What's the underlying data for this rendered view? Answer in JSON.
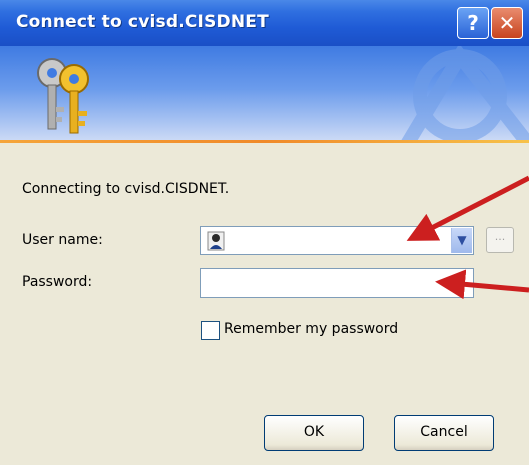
{
  "window": {
    "title": "Connect to cvisd.CISDNET"
  },
  "titlebar": {
    "help_glyph": "?",
    "close_glyph": "✕"
  },
  "dialog": {
    "message": "Connecting to cvisd.CISDNET.",
    "username_label": "User name:",
    "username_value": "",
    "password_label": "Password:",
    "password_value": "",
    "browse_label": "...",
    "remember_label": "Remember my password",
    "remember_checked": false,
    "ok_label": "OK",
    "cancel_label": "Cancel"
  },
  "colors": {
    "titlebar": "#1f5bd6",
    "annotation_arrow": "#cc1f1f",
    "dialog_bg": "#ece9d8"
  },
  "icons": [
    "keys-icon",
    "user-icon",
    "chevron-down-icon",
    "help-icon",
    "close-icon",
    "annotation-arrow"
  ]
}
